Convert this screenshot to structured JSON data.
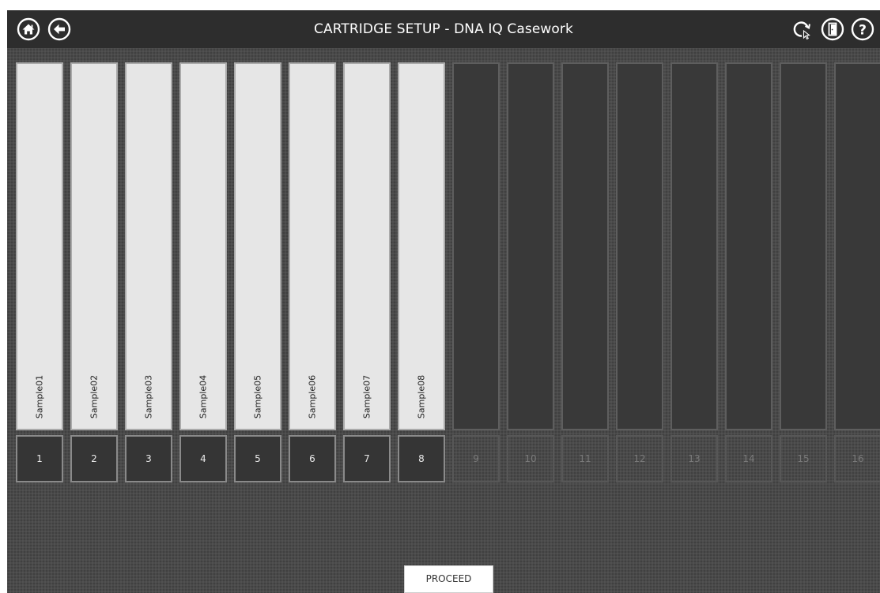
{
  "header": {
    "title": "CARTRIDGE SETUP - DNA IQ Casework",
    "left_icons": [
      "home-icon",
      "back-arrow-icon"
    ],
    "right_icons": [
      "refresh-search-icon",
      "logout-door-icon",
      "help-icon"
    ]
  },
  "slots": [
    {
      "number": "1",
      "sample": "Sample01"
    },
    {
      "number": "2",
      "sample": "Sample02"
    },
    {
      "number": "3",
      "sample": "Sample03"
    },
    {
      "number": "4",
      "sample": "Sample04"
    },
    {
      "number": "5",
      "sample": "Sample05"
    },
    {
      "number": "6",
      "sample": "Sample06"
    },
    {
      "number": "7",
      "sample": "Sample07"
    },
    {
      "number": "8",
      "sample": "Sample08"
    },
    {
      "number": "9",
      "sample": ""
    },
    {
      "number": "10",
      "sample": ""
    },
    {
      "number": "11",
      "sample": ""
    },
    {
      "number": "12",
      "sample": ""
    },
    {
      "number": "13",
      "sample": ""
    },
    {
      "number": "14",
      "sample": ""
    },
    {
      "number": "15",
      "sample": ""
    },
    {
      "number": "16",
      "sample": ""
    }
  ],
  "footer": {
    "proceed_label": "PROCEED"
  },
  "colors": {
    "header_bg": "#2d2d2d",
    "background": "#4a4a4a",
    "filled_slot": "#e6e6e6",
    "empty_slot": "#393939"
  }
}
